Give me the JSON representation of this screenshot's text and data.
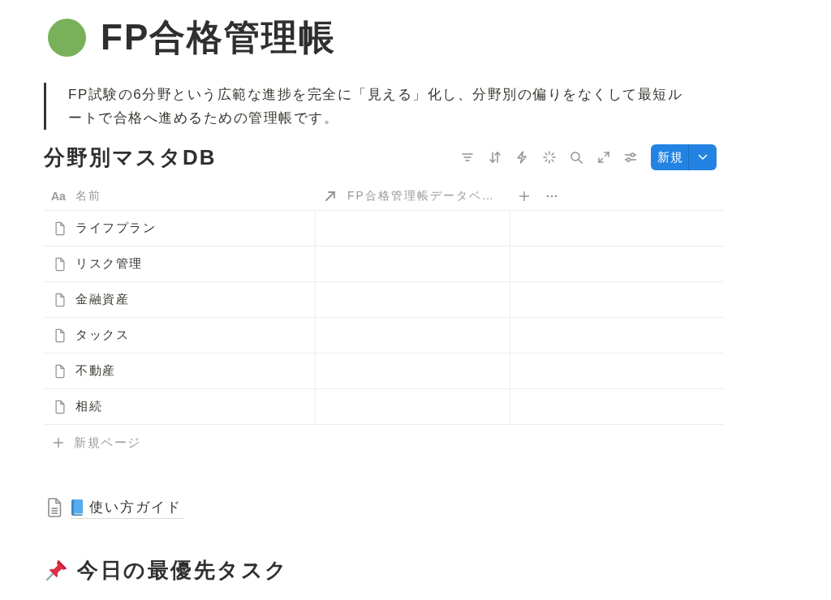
{
  "page": {
    "title": "FP合格管理帳",
    "quote": "FP試験の6分野という広範な進捗を完全に「見える」化し、分野別の偏りをなくして最短ルートで合格へ進めるための管理帳です。"
  },
  "database": {
    "title": "分野別マスタDB",
    "new_button": "新規",
    "columns": [
      {
        "kind": "title",
        "type_label": "Aa",
        "label": "名前"
      },
      {
        "kind": "relation",
        "label": "FP合格管理帳データベ…"
      }
    ],
    "rows": [
      {
        "name": "ライフプラン"
      },
      {
        "name": "リスク管理"
      },
      {
        "name": "金融資産"
      },
      {
        "name": "タックス"
      },
      {
        "name": "不動産"
      },
      {
        "name": "相続"
      }
    ],
    "add_row": "新規ページ"
  },
  "link": {
    "label": "使い方ガイド"
  },
  "heading": {
    "text": "今日の最優先タスク"
  }
}
